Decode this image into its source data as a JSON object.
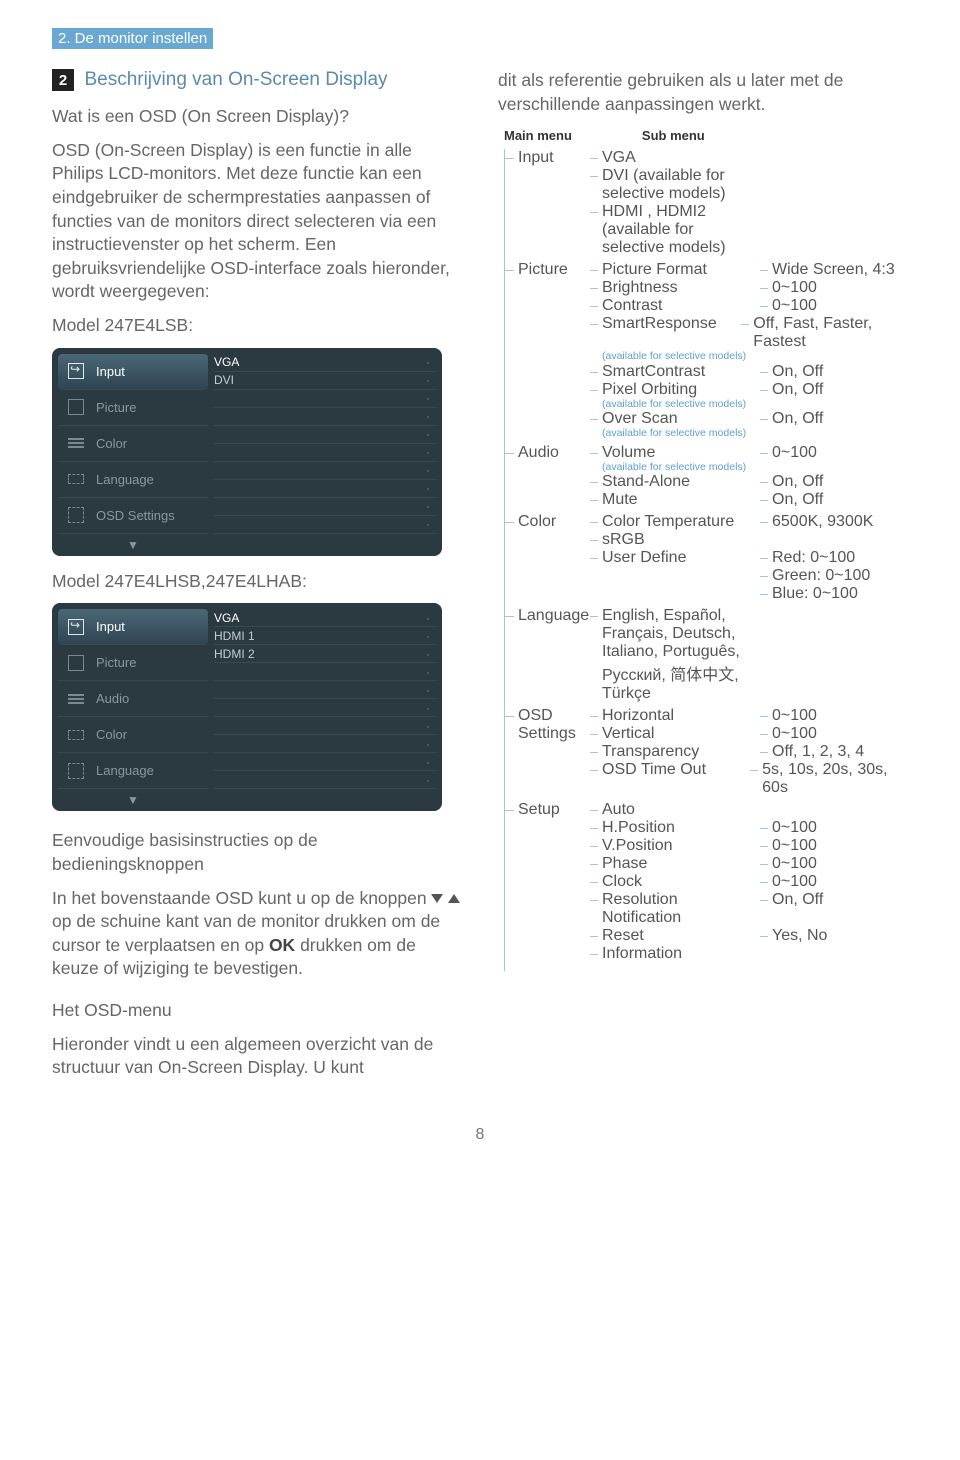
{
  "topbar": "2. De monitor instellen",
  "section_number": "2",
  "section_title": "Beschrijving van On-Screen Display",
  "q_title": "Wat is een OSD (On Screen Display)?",
  "p1": "OSD (On-Screen Display) is een functie in alle Philips LCD-monitors. Met deze functie kan een eindgebruiker de schermprestaties aanpassen of functies van de monitors direct selecteren via een instructievenster op het scherm. Een gebruiksvriendelijke OSD-interface zoals hieronder, wordt weergegeven:",
  "model_a": "Model 247E4LSB:",
  "model_b": "Model 247E4LHSB,247E4LHAB:",
  "osd_a": {
    "menu": [
      "Input",
      "Picture",
      "Color",
      "Language",
      "OSD Settings"
    ],
    "opts": [
      "VGA",
      "DVI"
    ]
  },
  "osd_b": {
    "menu": [
      "Input",
      "Picture",
      "Audio",
      "Color",
      "Language"
    ],
    "opts": [
      "VGA",
      "HDMI 1",
      "HDMI 2"
    ]
  },
  "basis_head": "Eenvoudige basisinstructies op de bedieningsknoppen",
  "basis_text_a": "In het bovenstaande OSD kunt u op de knoppen ",
  "basis_text_b": " op de schuine kant van de monitor drukken om de cursor te verplaatsen en op ",
  "basis_text_ok": "OK",
  "basis_text_c": " drukken om de keuze of wijziging te bevestigen.",
  "osdm_head": "Het OSD-menu",
  "osdm_text": "Hieronder vindt u een algemeen overzicht van de structuur van On-Screen Display. U kunt",
  "ref_text": "dit als referentie gebruiken als u later met de verschillende aanpassingen werkt.",
  "head_main": "Main menu",
  "head_sub": "Sub menu",
  "tree": [
    {
      "main": "Input",
      "subs": [
        {
          "l": "VGA",
          "v": ""
        },
        {
          "l": "DVI (available for selective models)",
          "v": ""
        },
        {
          "l": "HDMI , HDMI2 (available for selective models)",
          "v": ""
        }
      ]
    },
    {
      "main": "Picture",
      "subs": [
        {
          "l": "Picture Format",
          "v": "Wide Screen, 4:3"
        },
        {
          "l": "Brightness",
          "v": "0~100"
        },
        {
          "l": "Contrast",
          "v": "0~100"
        },
        {
          "l": "SmartResponse",
          "v": "Off, Fast, Faster, Fastest",
          "n": "(available for selective models)"
        },
        {
          "l": "SmartContrast",
          "v": "On, Off"
        },
        {
          "l": "Pixel Orbiting",
          "v": "On, Off",
          "n": "(available for selective models)"
        },
        {
          "l": "Over Scan",
          "v": "On, Off",
          "n": "(available for selective models)"
        }
      ]
    },
    {
      "main": "Audio",
      "subs": [
        {
          "l": "Volume",
          "v": "0~100",
          "n": "(available for selective models)"
        },
        {
          "l": "Stand-Alone",
          "v": "On, Off"
        },
        {
          "l": "Mute",
          "v": "On, Off"
        }
      ]
    },
    {
      "main": "Color",
      "subs": [
        {
          "l": "Color Temperature",
          "v": "6500K, 9300K"
        },
        {
          "l": "sRGB",
          "v": ""
        },
        {
          "l": "User Define",
          "v": "Red: 0~100"
        },
        {
          "l": "",
          "v": "Green: 0~100"
        },
        {
          "l": "",
          "v": "Blue: 0~100"
        }
      ]
    },
    {
      "main": "Language",
      "subs": [
        {
          "l": "English, Español, Français, Deutsch, Italiano, Português, Русский, 简体中文, Türkçe",
          "v": ""
        }
      ]
    },
    {
      "main": "OSD Settings",
      "subs": [
        {
          "l": "Horizontal",
          "v": "0~100"
        },
        {
          "l": "Vertical",
          "v": "0~100"
        },
        {
          "l": "Transparency",
          "v": "Off, 1, 2, 3, 4"
        },
        {
          "l": "OSD Time Out",
          "v": "5s, 10s, 20s, 30s, 60s"
        }
      ]
    },
    {
      "main": "Setup",
      "subs": [
        {
          "l": "Auto",
          "v": ""
        },
        {
          "l": "H.Position",
          "v": "0~100"
        },
        {
          "l": "V.Position",
          "v": "0~100"
        },
        {
          "l": "Phase",
          "v": "0~100"
        },
        {
          "l": "Clock",
          "v": "0~100"
        },
        {
          "l": "Resolution Notification",
          "v": "On, Off"
        },
        {
          "l": "Reset",
          "v": "Yes, No"
        },
        {
          "l": "Information",
          "v": ""
        }
      ]
    }
  ],
  "page_number": "8"
}
